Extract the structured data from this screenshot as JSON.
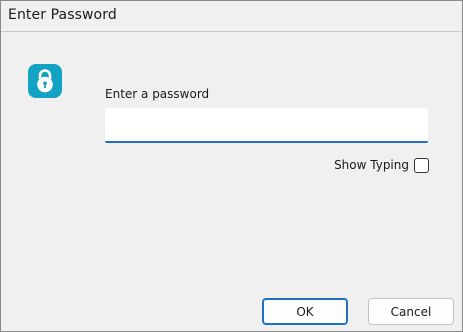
{
  "window": {
    "title": "Enter Password"
  },
  "dialog": {
    "icon": "padlock-icon",
    "prompt": "Enter a password",
    "password_value": "",
    "show_typing_label": "Show Typing",
    "show_typing_checked": false
  },
  "buttons": {
    "ok": "OK",
    "cancel": "Cancel"
  },
  "colors": {
    "accent": "#1f6fc9",
    "icon_bg": "#12a2c4",
    "background": "#f0f0f0"
  }
}
